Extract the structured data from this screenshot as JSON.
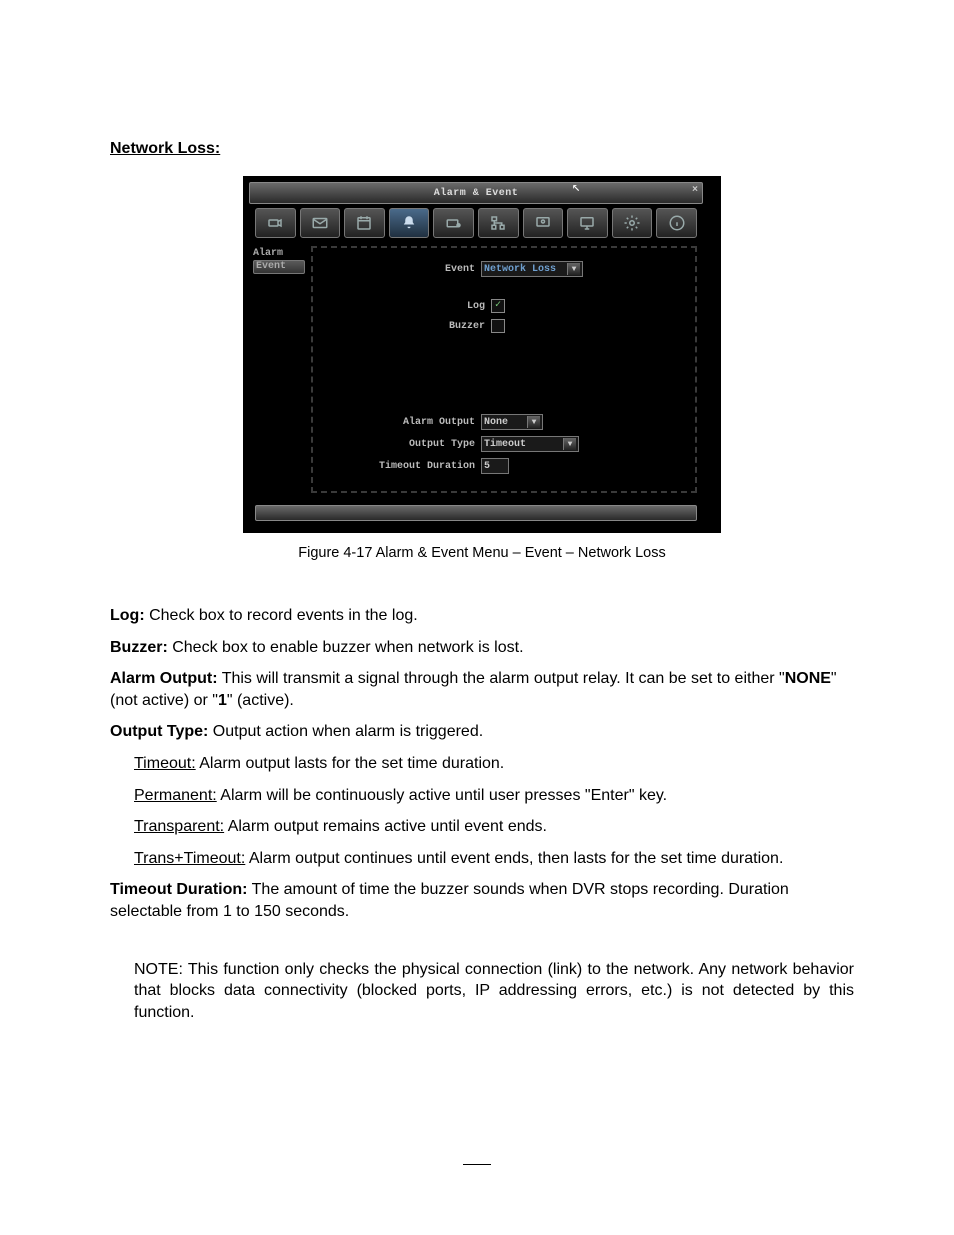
{
  "heading": "Network Loss:",
  "window": {
    "title": "Alarm & Event",
    "toolbar_icons": [
      "camera-icon",
      "envelope-icon",
      "calendar-icon",
      "bell-icon",
      "rec-disk-icon",
      "network-icon",
      "display-icon",
      "monitor-icon",
      "gear-icon",
      "info-icon"
    ],
    "sidebar": {
      "items": [
        "Alarm",
        "Event"
      ],
      "selected_index": 1
    },
    "form": {
      "event_label": "Event",
      "event_value": "Network Loss",
      "log_label": "Log",
      "log_checked": true,
      "buzzer_label": "Buzzer",
      "buzzer_checked": false,
      "alarm_output_label": "Alarm Output",
      "alarm_output_value": "None",
      "output_type_label": "Output Type",
      "output_type_value": "Timeout",
      "timeout_duration_label": "Timeout Duration",
      "timeout_duration_value": "5"
    }
  },
  "caption": "Figure 4-17 Alarm & Event Menu – Event – Network Loss",
  "body": {
    "log": {
      "label": "Log:",
      "text": " Check box to record events in the log."
    },
    "buzzer": {
      "label": "Buzzer:",
      "text": " Check box to enable buzzer when network is lost."
    },
    "alarm_output": {
      "label": "Alarm Output:",
      "text_pre": " This will transmit a signal through the alarm output relay. It can be set to either \"",
      "bold1": "NONE",
      "text_mid": "\" (not active) or \"",
      "bold2": "1",
      "text_post": "\" (active)."
    },
    "output_type": {
      "label": "Output Type:",
      "text": " Output action when alarm is triggered."
    },
    "timeout": {
      "label": "Timeout:",
      "text": " Alarm output lasts for the set time duration."
    },
    "permanent": {
      "label": "Permanent:",
      "text_pre": " Alarm will be continuously active until user presses \"",
      "bold": "Enter",
      "text_post": "\" key."
    },
    "transparent": {
      "label": "Transparent:",
      "text": " Alarm output remains active until event ends."
    },
    "trans_timeout": {
      "label": "Trans+Timeout:",
      "text": " Alarm output continues until event ends, then lasts for the set time duration."
    },
    "timeout_duration": {
      "label": "Timeout Duration:",
      "text": " The amount of time the buzzer sounds when DVR stops recording. Duration selectable from 1 to 150 seconds."
    },
    "note": {
      "label": "NOTE:",
      "text": " This function only checks the physical connection (link) to the network. Any network behavior that blocks data connectivity (blocked ports, IP addressing errors, etc.) is not detected by this function."
    }
  }
}
